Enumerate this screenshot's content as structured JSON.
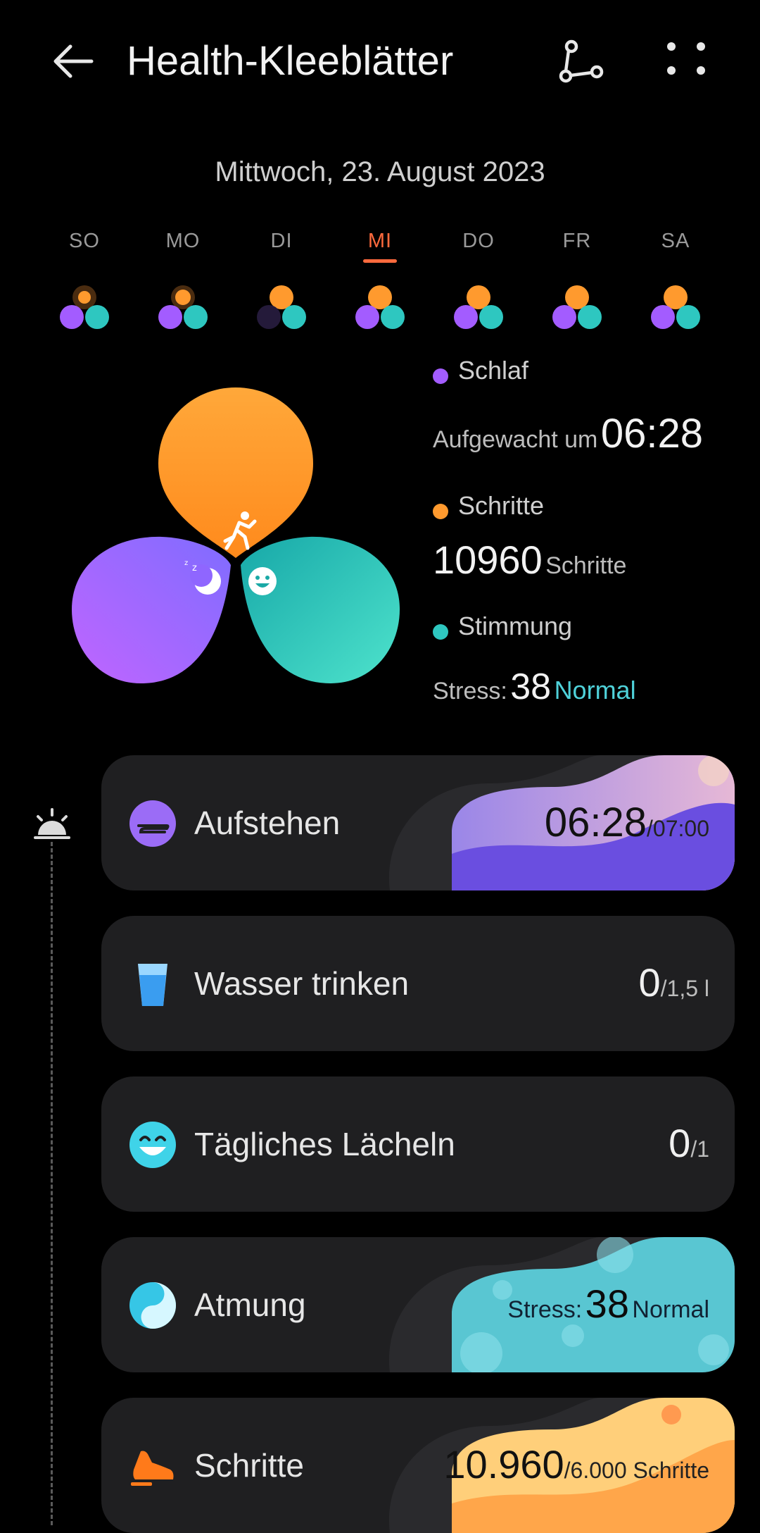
{
  "header": {
    "title": "Health-Kleeblätter"
  },
  "date": "Mittwoch, 23. August 2023",
  "week": [
    {
      "label": "SO",
      "active": false
    },
    {
      "label": "MO",
      "active": false
    },
    {
      "label": "DI",
      "active": false
    },
    {
      "label": "MI",
      "active": true
    },
    {
      "label": "DO",
      "active": false
    },
    {
      "label": "FR",
      "active": false
    },
    {
      "label": "SA",
      "active": false
    }
  ],
  "legend": {
    "sleep_label": "Schlaf",
    "sleep_prefix": "Aufgewacht um",
    "sleep_value": "06:28",
    "steps_label": "Schritte",
    "steps_value": "10960",
    "steps_unit": "Schritte",
    "mood_label": "Stimmung",
    "stress_prefix": "Stress:",
    "stress_value": "38",
    "stress_status": "Normal"
  },
  "cards": {
    "wake": {
      "name": "Aufstehen",
      "value": "06:28",
      "target": "/07:00"
    },
    "water": {
      "name": "Wasser trinken",
      "value": "0",
      "target": "/1,5 l"
    },
    "smile": {
      "name": "Tägliches Lächeln",
      "value": "0",
      "target": "/1"
    },
    "breath": {
      "name": "Atmung",
      "prefix": "Stress:",
      "value": "38",
      "status": "Normal"
    },
    "steps": {
      "name": "Schritte",
      "value": "10.960",
      "target": "/6.000 Schritte"
    }
  },
  "colors": {
    "accent": "#ff6a3d",
    "sleep": "#a35cff",
    "steps": "#ff9a2e",
    "mood": "#2ec7c0",
    "teal_text": "#4fd1d9"
  }
}
